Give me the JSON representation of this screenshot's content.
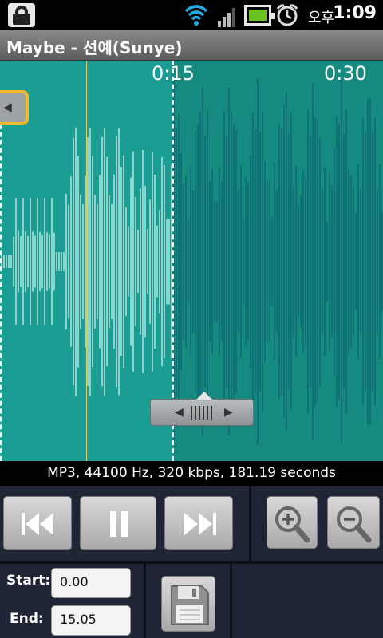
{
  "status_bar": {
    "icons": [
      "lock-icon",
      "wifi-icon",
      "signal-icon",
      "battery-icon",
      "alarm-icon"
    ],
    "ampm": "오후",
    "time": "1:09"
  },
  "title": "Maybe - 선예(Sunye)",
  "waveform": {
    "time_labels": [
      "0:15",
      "0:30"
    ],
    "colors": {
      "selected": "#1c9d93",
      "unselected": "#158b80",
      "wave_selected": "#d8f7f2",
      "wave_unselected": "#0f5f6e"
    }
  },
  "info": "MP3, 44100 Hz, 320 kbps, 181.19 seconds",
  "controls": {
    "buttons": [
      "rewind",
      "pause",
      "fast-forward",
      "zoom-in",
      "zoom-out",
      "save"
    ],
    "start_label": "Start:",
    "start_value": "0.00",
    "end_label": "End:",
    "end_value": "15.05"
  }
}
